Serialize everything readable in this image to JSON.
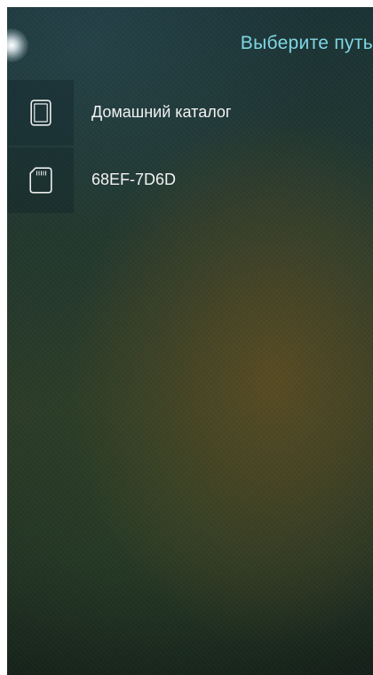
{
  "header": {
    "title": "Выберите путь"
  },
  "locations": [
    {
      "label": "Домашний каталог",
      "icon": "phone-icon"
    },
    {
      "label": "68EF-7D6D",
      "icon": "sd-card-icon"
    }
  ],
  "colors": {
    "accent": "#7fd6e4",
    "text": "#f2f2f2"
  }
}
